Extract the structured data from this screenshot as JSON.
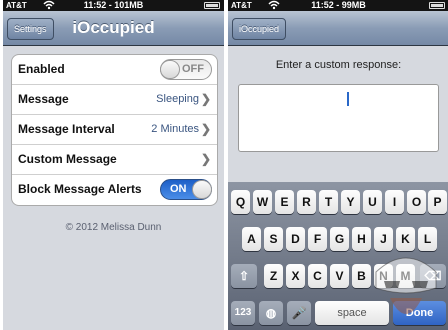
{
  "left": {
    "status": {
      "carrier": "AT&T",
      "time": "11:52 - 101MB"
    },
    "navbar": {
      "back_label": "Settings",
      "title": "iOccupied"
    },
    "rows": [
      {
        "label": "Enabled",
        "switch": "OFF",
        "switch_state": "off"
      },
      {
        "label": "Message",
        "value": "Sleeping"
      },
      {
        "label": "Message Interval",
        "value": "2 Minutes"
      },
      {
        "label": "Custom Message"
      },
      {
        "label": "Block Message Alerts",
        "switch": "ON",
        "switch_state": "on"
      }
    ],
    "footer": "© 2012 Melissa Dunn"
  },
  "right": {
    "status": {
      "carrier": "AT&T",
      "time": "11:52 - 99MB"
    },
    "navbar": {
      "back_label": "iOccupied"
    },
    "prompt": "Enter a custom response:",
    "keyboard": {
      "row1": [
        "Q",
        "W",
        "E",
        "R",
        "T",
        "Y",
        "U",
        "I",
        "O",
        "P"
      ],
      "row2": [
        "A",
        "S",
        "D",
        "F",
        "G",
        "H",
        "J",
        "K",
        "L"
      ],
      "row3": [
        "Z",
        "X",
        "C",
        "V",
        "B",
        "N",
        "M"
      ],
      "numbers_key": "123",
      "space_key": "space",
      "done_key": "Done"
    }
  },
  "icons": {
    "wifi": "wifi-icon",
    "battery": "battery-icon",
    "chevron": "chevron-right-icon",
    "shift": "shift-icon",
    "delete": "delete-icon",
    "globe": "globe-icon",
    "mic": "microphone-icon",
    "watermark": "mask-figure-watermark"
  },
  "colors": {
    "navbar": "#8a9cb5",
    "switch_on": "#2f64c4",
    "value_text": "#3a5580"
  }
}
